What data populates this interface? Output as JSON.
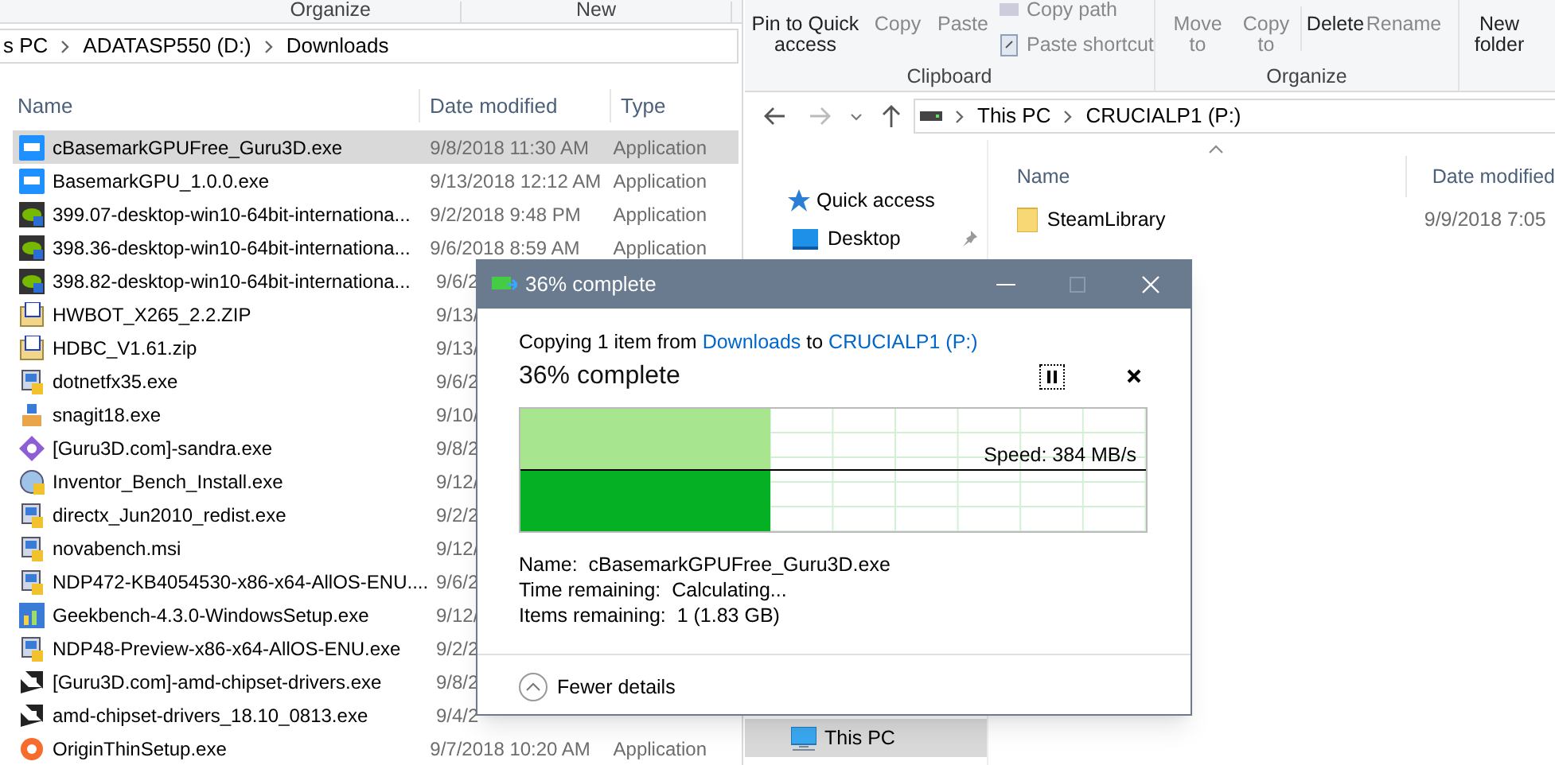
{
  "downloads_window": {
    "ribbon_groups": [
      "Organize",
      "New"
    ],
    "breadcrumb": [
      "s PC",
      "ADATASP550 (D:)",
      "Downloads"
    ],
    "columns": [
      "Name",
      "Date modified",
      "Type"
    ],
    "rows": [
      {
        "kind": "bm",
        "name": "cBasemarkGPUFree_Guru3D.exe",
        "date": "9/8/2018 11:30 AM",
        "type": "Application",
        "selected": true
      },
      {
        "kind": "bm",
        "name": "BasemarkGPU_1.0.0.exe",
        "date": "9/13/2018 12:12 AM",
        "type": "Application",
        "selected": false
      },
      {
        "kind": "driver",
        "name": "399.07-desktop-win10-64bit-internationa...",
        "date": "9/2/2018 9:48 PM",
        "type": "Application",
        "selected": false
      },
      {
        "kind": "driver",
        "name": "398.36-desktop-win10-64bit-internationa...",
        "date": "9/6/2018 8:59 AM",
        "type": "Application",
        "selected": false
      },
      {
        "kind": "driver",
        "name": "398.82-desktop-win10-64bit-internationa...",
        "date": "9/6/2",
        "selected": false
      },
      {
        "kind": "zip",
        "name": "HWBOT_X265_2.2.ZIP",
        "date": "9/13/",
        "selected": false
      },
      {
        "kind": "zip",
        "name": "HDBC_V1.61.zip",
        "date": "9/13/",
        "selected": false
      },
      {
        "kind": "setup",
        "name": "dotnetfx35.exe",
        "date": "9/6/2",
        "selected": false
      },
      {
        "kind": "box",
        "name": "snagit18.exe",
        "date": "9/10/",
        "selected": false
      },
      {
        "kind": "diamond",
        "name": "[Guru3D.com]-sandra.exe",
        "date": "9/8/2",
        "selected": false
      },
      {
        "kind": "disc",
        "name": "Inventor_Bench_Install.exe",
        "date": "9/12/",
        "selected": false
      },
      {
        "kind": "setup",
        "name": "directx_Jun2010_redist.exe",
        "date": "9/2/2",
        "selected": false
      },
      {
        "kind": "setup",
        "name": "novabench.msi",
        "date": "9/12/",
        "selected": false
      },
      {
        "kind": "setup",
        "name": "NDP472-KB4054530-x86-x64-AllOS-ENU....",
        "date": "9/6/2",
        "selected": false
      },
      {
        "kind": "bars",
        "name": "Geekbench-4.3.0-WindowsSetup.exe",
        "date": "9/12/",
        "selected": false
      },
      {
        "kind": "setup",
        "name": "NDP48-Preview-x86-x64-AllOS-ENU.exe",
        "date": "9/2/2",
        "selected": false
      },
      {
        "kind": "amd",
        "name": "[Guru3D.com]-amd-chipset-drivers.exe",
        "date": "9/8/2",
        "selected": false
      },
      {
        "kind": "amd",
        "name": "amd-chipset-drivers_18.10_0813.exe",
        "date": "9/4/2",
        "selected": false
      },
      {
        "kind": "origin",
        "name": "OriginThinSetup.exe",
        "date": "9/7/2018 10:20 AM",
        "type": "Application",
        "selected": false
      }
    ]
  },
  "drive_window": {
    "ribbon": {
      "pin": "Pin to Quick access",
      "copy": "Copy",
      "paste": "Paste",
      "copy_path": "Copy path",
      "paste_shortcut": "Paste shortcut",
      "clipboard_group": "Clipboard",
      "move_to": "Move to",
      "copy_to": "Copy to",
      "delete": "Delete",
      "rename": "Rename",
      "organize_group": "Organize",
      "new_folder": "New folder"
    },
    "breadcrumb": [
      "This PC",
      "CRUCIALP1 (P:)"
    ],
    "nav": [
      {
        "kind": "star",
        "label": "Quick access",
        "selected": false
      },
      {
        "kind": "desktop",
        "label": "Desktop",
        "selected": false,
        "pinned": true
      },
      {
        "kind": "pc",
        "label": "This PC",
        "selected": true
      }
    ],
    "columns": [
      "Name",
      "Date modified"
    ],
    "rows": [
      {
        "name": "SteamLibrary",
        "date": "9/9/2018 7:05"
      }
    ]
  },
  "copy_dialog": {
    "title": "36% complete",
    "status": {
      "before": "Copying 1 item from",
      "source": "Downloads",
      "middle": "to",
      "destination": "CRUCIALP1 (P:)"
    },
    "heading": "36% complete",
    "level": 0.4,
    "speed": "Speed: 384 MB/s",
    "details": [
      {
        "label": "Name:",
        "value": "cBasemarkGPUFree_Guru3D.exe"
      },
      {
        "label": "Time remaining:",
        "value": "Calculating..."
      },
      {
        "label": "Items remaining:",
        "value": "1 (1.83 GB)"
      }
    ],
    "toggle": "Fewer details"
  }
}
